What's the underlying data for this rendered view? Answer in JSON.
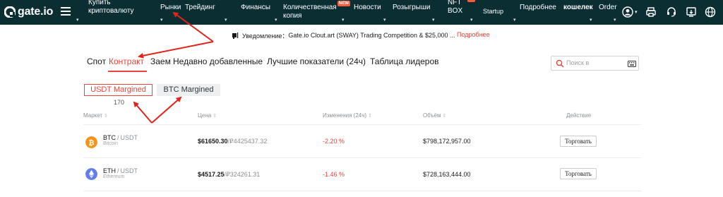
{
  "brand": {
    "name": "gate.io",
    "accent": "#e8443b",
    "nav_bg": "#0b2e33"
  },
  "nav": {
    "items": [
      {
        "label_line1": "Купить",
        "label_line2": "криптовалюту"
      },
      {
        "label_line1": "Рынки"
      },
      {
        "label_line1": "Трейдинг"
      },
      {
        "label_line1": "Финансы"
      },
      {
        "label_line1": "Количественная",
        "label_line2": "копия",
        "badge": "NEW"
      },
      {
        "label_line1": "Новости"
      },
      {
        "label_line1": "Розыгрыши"
      },
      {
        "label_line1": "NFT",
        "label_line2": "BOX"
      },
      {
        "label_line1": "Startup"
      },
      {
        "label_line1": "Подробнее"
      },
      {
        "label_line1": "кошелек"
      },
      {
        "label_line1": "Order"
      }
    ],
    "icons": [
      "user-icon",
      "printer-icon",
      "support-icon",
      "download-icon",
      "globe-icon"
    ]
  },
  "notice": {
    "label": "Уведомление：",
    "text": "Gate.io Clout.art (SWAY) Trading Competition & $25,000 ...",
    "more": "Подробнее"
  },
  "tabs": [
    "Спот",
    "Контракт",
    "Заем",
    "Недавно добавленные",
    "Лучшие показатели (24ч)",
    "Таблица лидеров"
  ],
  "active_tab": "Контракт",
  "search": {
    "placeholder": "Поиск в"
  },
  "margin": {
    "usdt": "USDT Margined",
    "btc": "BTC Margined",
    "count": "170"
  },
  "table": {
    "headers": [
      "Маркет",
      "Цена",
      "Изменения (24ч)",
      "Объём",
      "Действие"
    ],
    "rows": [
      {
        "base": "BTC",
        "quote": "USDT",
        "name": "Bitcoin",
        "price": "$61650.30",
        "price_alt": "/₽4425437.32",
        "change": "-2.20 %",
        "volume": "$798,172,957.00",
        "action": "Торговать",
        "icon_color": "#f7931a"
      },
      {
        "base": "ETH",
        "quote": "USDT",
        "name": "Ethereum",
        "price": "$4517.25",
        "price_alt": "/₽324261.31",
        "change": "-1.46 %",
        "volume": "$728,163,444.00",
        "action": "Торговать",
        "icon_color": "#627eea"
      }
    ]
  }
}
